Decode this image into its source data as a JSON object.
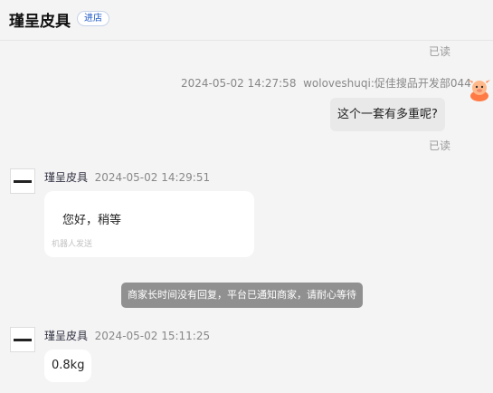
{
  "header": {
    "shop_name": "瑾呈皮具",
    "enter_label": "进店"
  },
  "messages": [
    {
      "read_status": "已读"
    },
    {
      "timestamp": "2024-05-02 14:27:58",
      "sender": "woloveshuqi:促佳搜品开发部044",
      "text": "这个一套有多重呢?",
      "read_status": "已读"
    },
    {
      "sender": "瑾呈皮具",
      "timestamp": "2024-05-02 14:29:51",
      "text": "您好，稍等",
      "robot_note": "机器人发送"
    },
    {
      "notice": "商家长时间没有回复，平台已通知商家，请耐心等待"
    },
    {
      "sender": "瑾呈皮具",
      "timestamp": "2024-05-02 15:11:25",
      "text": "0.8kg"
    }
  ],
  "colors": {
    "accent": "#1a56c4",
    "notice_bg": "#909090",
    "background": "#f4f4f4"
  }
}
